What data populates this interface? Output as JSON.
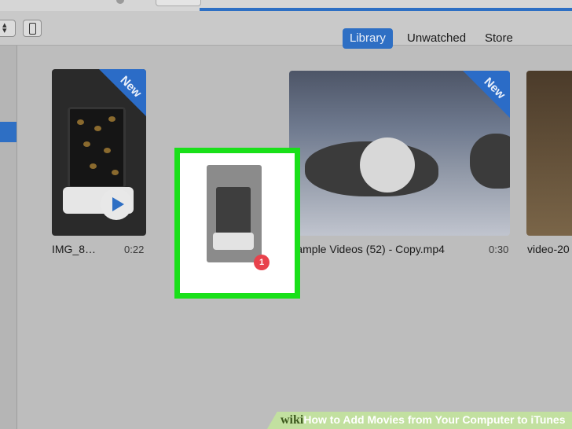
{
  "toolbar": {
    "tabs": [
      {
        "label": "Library",
        "active": true
      },
      {
        "label": "Unwatched",
        "active": false
      },
      {
        "label": "Store",
        "active": false
      }
    ],
    "sort_icon": "updown-arrows-icon",
    "device_icon": "iphone-icon"
  },
  "library": {
    "items": [
      {
        "title": "IMG_8…",
        "duration": "0:22",
        "badge": "New"
      },
      {
        "title": "Sample Videos (52) - Copy.mp4",
        "duration": "0:30",
        "badge": "New"
      },
      {
        "title": "video-20"
      }
    ]
  },
  "drag": {
    "count": "1",
    "highlight_color": "#19e019"
  },
  "colors": {
    "accent": "#2e6fc4",
    "badge": "#e8424c"
  },
  "banner": {
    "wiki": "wiki",
    "how": "How",
    "text": " to Add Movies from Your Computer to iTunes"
  }
}
